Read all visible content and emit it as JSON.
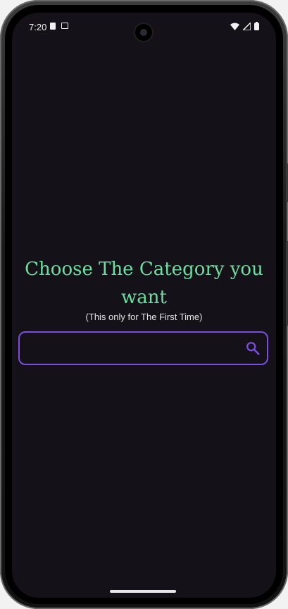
{
  "status_bar": {
    "time": "7:20",
    "icons": [
      "sd-card-icon",
      "screenshot-icon",
      "wifi-icon",
      "cellular-signal-icon",
      "battery-icon"
    ]
  },
  "main": {
    "title": "Choose The Category you want",
    "subtitle": "(This only for The First Time)",
    "search": {
      "value": "",
      "placeholder": ""
    }
  },
  "colors": {
    "background": "#141218",
    "title": "#6cdea0",
    "accent": "#7b4de0",
    "text": "#e4e4e4"
  }
}
